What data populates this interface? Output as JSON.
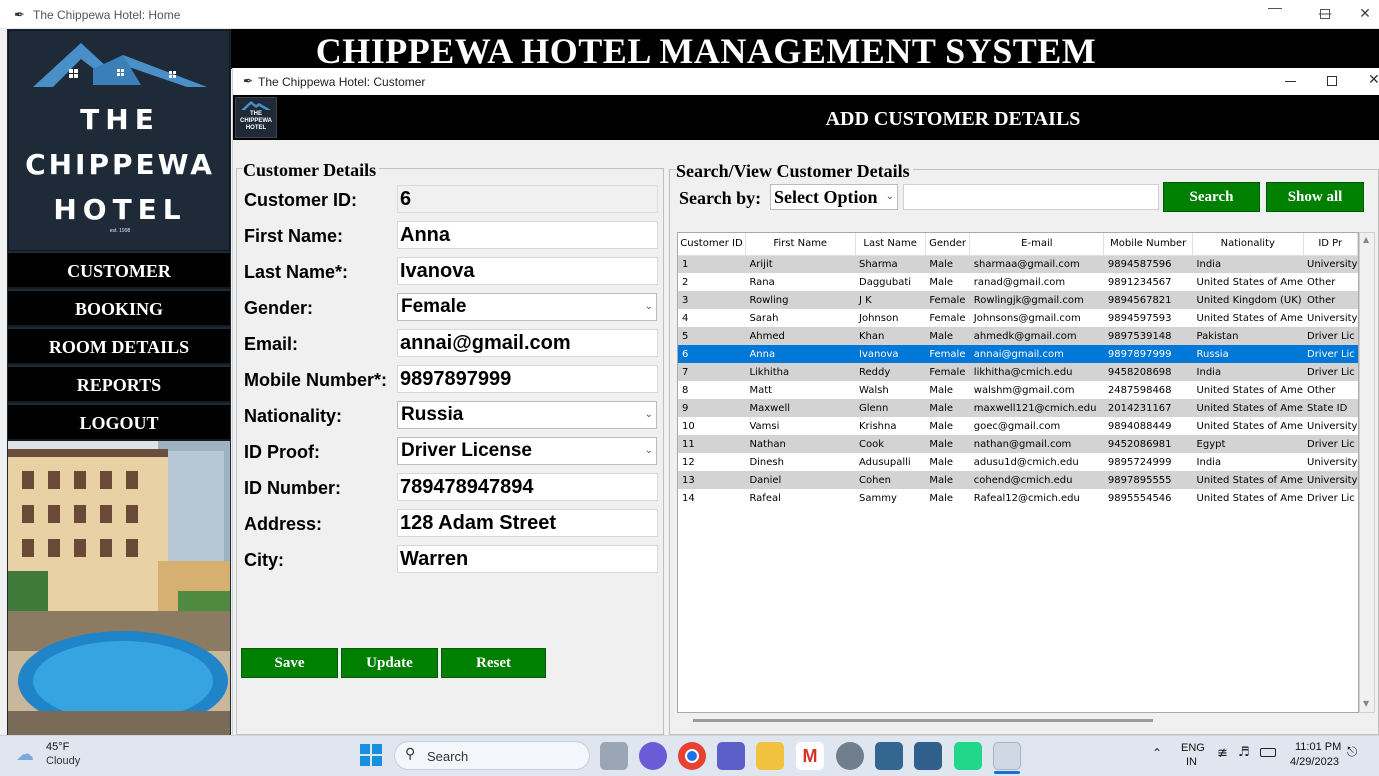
{
  "main_window": {
    "title": "The Chippewa Hotel: Home",
    "banner_title": "CHIPPEWA HOTEL MANAGEMENT SYSTEM"
  },
  "logo": {
    "line1": "THE",
    "line2": "CHIPPEWA",
    "line3": "HOTEL",
    "est": "est. 1998",
    "small_line1": "THE",
    "small_line2": "CHIPPEWA",
    "small_line3": "HOTEL"
  },
  "nav": {
    "customer": "CUSTOMER",
    "booking": "BOOKING",
    "room_details": "ROOM DETAILS",
    "reports": "REPORTS",
    "logout": "LOGOUT"
  },
  "customer_window": {
    "title": "The Chippewa Hotel: Customer",
    "banner_title": "ADD CUSTOMER DETAILS"
  },
  "customer_details": {
    "legend": "Customer Details",
    "labels": {
      "customer_id": "Customer ID:",
      "first_name": "First Name:",
      "last_name": "Last Name*:",
      "gender": "Gender:",
      "email": "Email:",
      "mobile": "Mobile Number*:",
      "nationality": "Nationality:",
      "id_proof": "ID Proof:",
      "id_number": "ID Number:",
      "address": "Address:",
      "city": "City:"
    },
    "values": {
      "customer_id": "6",
      "first_name": "Anna",
      "last_name": "Ivanova",
      "gender": "Female",
      "email": "annai@gmail.com",
      "mobile": "9897897999",
      "nationality": "Russia",
      "id_proof": "Driver License",
      "id_number": "789478947894",
      "address": "128 Adam Street",
      "city": "Warren"
    },
    "buttons": {
      "save": "Save",
      "update": "Update",
      "reset": "Reset"
    }
  },
  "search": {
    "legend": "Search/View Customer Details",
    "search_by_label": "Search by:",
    "select_value": "Select Option",
    "query": "",
    "search_button": "Search",
    "show_all_button": "Show all"
  },
  "table": {
    "columns": [
      "Customer ID",
      "First Name",
      "Last Name",
      "Gender",
      "E-mail",
      "Mobile Number",
      "Nationality",
      "ID Pr"
    ],
    "selected_row": 5,
    "rows": [
      [
        "1",
        "Arijit",
        "Sharma",
        "Male",
        "sharmaa@gmail.com",
        "9894587596",
        "India",
        "University"
      ],
      [
        "2",
        "Rana",
        "Daggubati",
        "Male",
        "ranad@gmail.com",
        "9891234567",
        "United States of Ame",
        "Other"
      ],
      [
        "3",
        "Rowling",
        "J K",
        "Female",
        "Rowlingjk@gmail.com",
        "9894567821",
        "United Kingdom (UK)",
        "Other"
      ],
      [
        "4",
        "Sarah",
        "Johnson",
        "Female",
        "Johnsons@gmail.com",
        "9894597593",
        "United States of Ame",
        "University"
      ],
      [
        "5",
        "Ahmed",
        "Khan",
        "Male",
        "ahmedk@gmail.com",
        "9897539148",
        "Pakistan",
        "Driver Lic"
      ],
      [
        "6",
        "Anna",
        "Ivanova",
        "Female",
        "annai@gmail.com",
        "9897897999",
        "Russia",
        "Driver Lic"
      ],
      [
        "7",
        "Likhitha",
        "Reddy",
        "Female",
        "likhitha@cmich.edu",
        "9458208698",
        "India",
        "Driver Lic"
      ],
      [
        "8",
        "Matt",
        "Walsh",
        "Male",
        "walshm@gmail.com",
        "2487598468",
        "United States of Ame",
        "Other"
      ],
      [
        "9",
        "Maxwell",
        "Glenn",
        "Male",
        "maxwell121@cmich.edu",
        "2014231167",
        "United States of Ame",
        "State ID"
      ],
      [
        "10",
        "Vamsi",
        "Krishna",
        "Male",
        "goec@gmail.com",
        "9894088449",
        "United States of Ame",
        "University"
      ],
      [
        "11",
        "Nathan",
        "Cook",
        "Male",
        "nathan@gmail.com",
        "9452086981",
        "Egypt",
        "Driver Lic"
      ],
      [
        "12",
        "Dinesh",
        "Adusupalli",
        "Male",
        "adusu1d@cmich.edu",
        "9895724999",
        "India",
        "University"
      ],
      [
        "13",
        "Daniel",
        "Cohen",
        "Male",
        "cohend@cmich.edu",
        "9897895555",
        "United States of Ame",
        "University"
      ],
      [
        "14",
        "Rafeal",
        "Sammy",
        "Male",
        "Rafeal12@cmich.edu",
        "9895554546",
        "United States of Ame",
        "Driver Lic"
      ]
    ]
  },
  "taskbar": {
    "weather_temp": "45°F",
    "weather_desc": "Cloudy",
    "search_label": "Search",
    "lang_line1": "ENG",
    "lang_line2": "IN",
    "time": "11:01 PM",
    "date": "4/29/2023"
  },
  "colors": {
    "accent_green": "#008000",
    "selection_blue": "#0078d7",
    "banner_black": "#000000",
    "logo_navy": "#1e2a38"
  }
}
